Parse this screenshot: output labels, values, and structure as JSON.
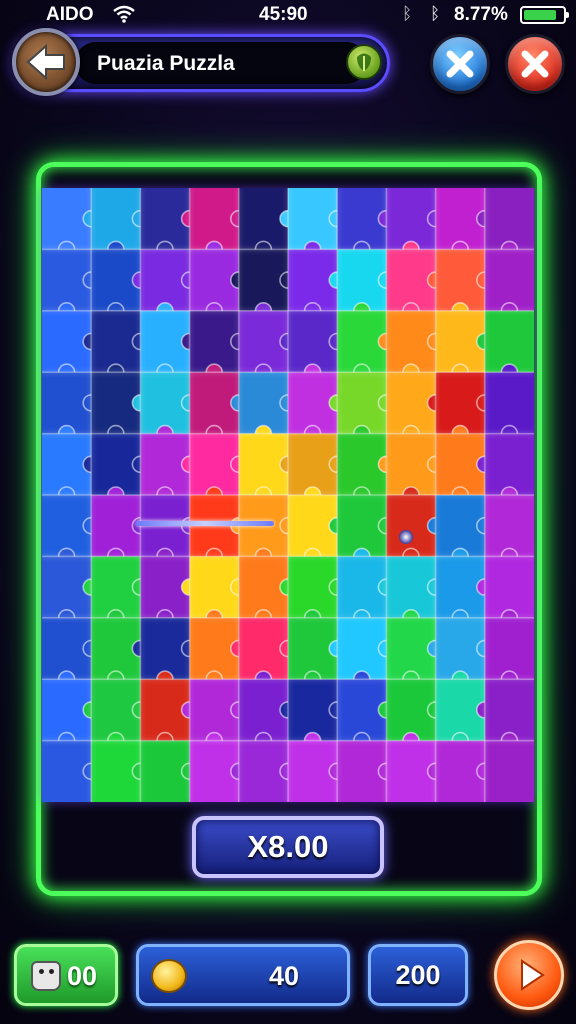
{
  "status_bar": {
    "carrier": "AIDO",
    "time": "45:90",
    "battery_percent": "8.77%",
    "battery_level": 0.85,
    "icons": [
      "wifi-icon",
      "bluetooth-icon",
      "bluetooth-icon",
      "battery-icon"
    ]
  },
  "header": {
    "title": "Puazia Puzzla",
    "back_icon": "arrow-left-icon",
    "leaf_icon": "leaf-icon",
    "close_blue_icon": "x-icon",
    "close_red_icon": "x-icon"
  },
  "board": {
    "columns": 10,
    "rows": 9,
    "frame_color": "#4dff5a",
    "tile_colors": [
      [
        "#3a7cff",
        "#1fa8e8",
        "#2a2a9a",
        "#d01a8a",
        "#1a1a6a",
        "#38c8ff",
        "#3a3ad0",
        "#7a28d8",
        "#c020d0",
        "#8a20c0"
      ],
      [
        "#2a5ae0",
        "#1a4ac8",
        "#7a2ae0",
        "#9a2ae0",
        "#18185a",
        "#7a2ae8",
        "#18d8f0",
        "#ff3a8a",
        "#ff5a3a",
        "#a020c8"
      ],
      [
        "#2a6aff",
        "#1a2a90",
        "#28b0ff",
        "#3a1a8a",
        "#7a2ad8",
        "#5a28c8",
        "#2ad83a",
        "#ff8a1a",
        "#ffb81a",
        "#1ec83a"
      ],
      [
        "#2050d0",
        "#162a80",
        "#20c0e0",
        "#c01a7a",
        "#2a8ad8",
        "#c030e0",
        "#78d82a",
        "#ffa81a",
        "#d81a1a",
        "#5a1ac8"
      ],
      [
        "#2a7aff",
        "#18289a",
        "#b028d8",
        "#ff2aa0",
        "#ffd81a",
        "#e8a018",
        "#2ac82a",
        "#ff9a1a",
        "#ff7a1a",
        "#7a20d0"
      ],
      [
        "#2060e0",
        "#a020d8",
        "#7a20d0",
        "#ff3a1a",
        "#ff9a1a",
        "#ffd81a",
        "#1ec83a",
        "#d82a1a",
        "#1a7ad8",
        "#b028d8"
      ],
      [
        "#2a58d8",
        "#20d040",
        "#8a20c8",
        "#ffd81a",
        "#ff7a1a",
        "#2ad82a",
        "#1ab8e8",
        "#18c8d8",
        "#1a9ae8",
        "#b028e0"
      ],
      [
        "#2050d0",
        "#1ec83a",
        "#1a2a9a",
        "#ff7a1a",
        "#ff2a6a",
        "#1ec83a",
        "#20c8ff",
        "#22d84a",
        "#28a8e8",
        "#a020d0"
      ],
      [
        "#2a6aff",
        "#1ec840",
        "#d82a1a",
        "#b028d8",
        "#7a20d0",
        "#1a28a0",
        "#2a48d8",
        "#1ac83a",
        "#1ad8a8",
        "#8a20c8"
      ],
      [
        "#2a58e0",
        "#1ed83a",
        "#1ac83a",
        "#c030e8",
        "#9a28d8",
        "#c030e8",
        "#b028d8",
        "#c030e8",
        "#b028d8",
        "#9a20c8"
      ]
    ]
  },
  "multiplier": {
    "label": "X8.00"
  },
  "bottom_bar": {
    "left_value": "00",
    "left_icon": "bag-icon",
    "coins_value": "40",
    "coin_icon": "coin-icon",
    "score_value": "200",
    "play_icon": "play-icon"
  }
}
